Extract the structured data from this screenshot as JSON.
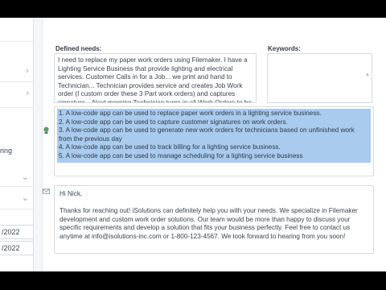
{
  "sidebar": {
    "partial_label": "ring",
    "date_1": "/2022",
    "date_2": "/2022"
  },
  "form": {
    "defined_needs_label": "Defined needs:",
    "keywords_label": "Keywords:",
    "defined_needs_text": "I need to replace my paper work orders using Filemaker. I have a Lighting Service Business that provide lighting and electrical services. Customer Calls in for a Job... we print and hand to Technician... Technician provides service and creates Job Work order (I custom order these 3 Part work orders) and captures signature... Next morning Technician turns in all Work Orders to be billed or continue performing unfinished work (where we",
    "keywords_text": ""
  },
  "ideas": [
    "1. A low-code app can be used to replace paper work orders in a lighting service business.",
    "2. A low-code app can be used to capture customer signatures on work orders.",
    "3. A low-code app can be used to generate new work orders for technicians based on unfinished work from the previous day",
    "4. A low-code app can be used to track billing for a lighting service business.",
    "5. A low-code app can be used to manage scheduling for a lighting service business"
  ],
  "email": {
    "greeting": "Hi Nick,",
    "body": "Thanks for reaching out! iSolutions can definitely help you with your needs. We specialize in Filemaker development and custom work order solutions. Our team would be more than happy to discuss your specific requirements and develop a solution that fits your business perfectly. Feel free to contact us anytime at info@isolutions-inc.com or 1-800-123-4567. We look forward to hearing from you soon!"
  },
  "icons": {
    "ideas": "lightbulb-icon",
    "email": "mail-icon"
  },
  "colors": {
    "selection": "#a9cbee",
    "text": "#3a4450"
  }
}
